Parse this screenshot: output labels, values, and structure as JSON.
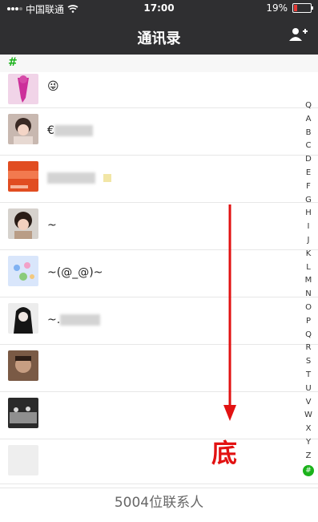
{
  "status_bar": {
    "carrier": "中国联通",
    "time": "17:00",
    "battery": "19%"
  },
  "header": {
    "title": "通讯录",
    "add_icon": "add-contact-icon"
  },
  "section": {
    "label": "#"
  },
  "contacts": [
    {
      "name": "😜"
    },
    {
      "name": "€"
    },
    {
      "name": ""
    },
    {
      "name": "~"
    },
    {
      "name": "~(@_@)~"
    },
    {
      "name": "~."
    },
    {
      "name": ""
    },
    {
      "name": ""
    },
    {
      "name": ""
    }
  ],
  "index_letters": [
    "Q",
    "A",
    "B",
    "C",
    "D",
    "E",
    "F",
    "G",
    "H",
    "I",
    "J",
    "K",
    "L",
    "M",
    "N",
    "O",
    "P",
    "Q",
    "R",
    "S",
    "T",
    "U",
    "V",
    "W",
    "X",
    "Y",
    "Z",
    "#"
  ],
  "annotation": {
    "text": "底",
    "color": "#e21212"
  },
  "footer": {
    "count_text": "5004位联系人"
  },
  "colors": {
    "topbar": "#2f2f31",
    "accent_green": "#1bb21b"
  }
}
